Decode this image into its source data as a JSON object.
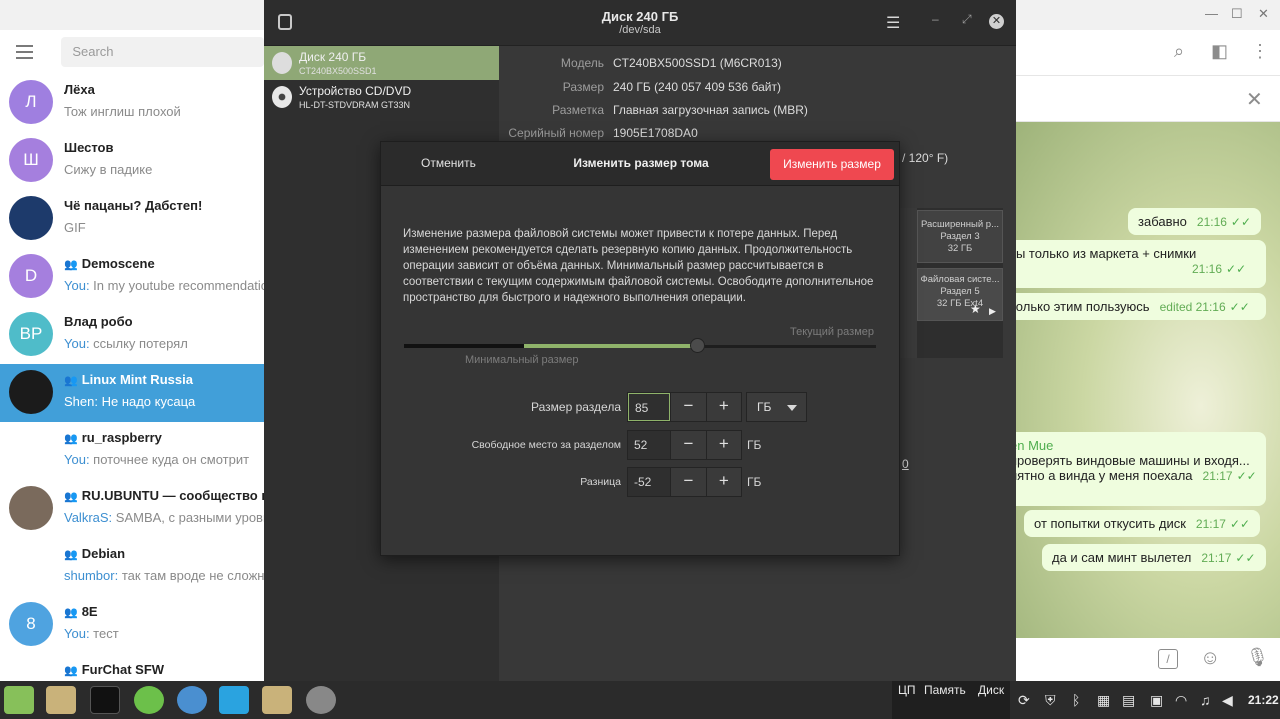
{
  "telegram": {
    "search_placeholder": "Search",
    "chats": [
      {
        "avatar": "Л",
        "avatar_color": "#9f7fe0",
        "name": "Лёха",
        "who": "",
        "preview": "Тож инглиш плохой",
        "group": false
      },
      {
        "avatar": "Ш",
        "avatar_color": "#a57fde",
        "name": "Шестов",
        "who": "",
        "preview": "Сижу в падике",
        "group": false
      },
      {
        "avatar": "",
        "avatar_color": "#1d3a6b",
        "name": "Чё пацаны? Дабстеп!",
        "who": "",
        "preview": "GIF",
        "group": false
      },
      {
        "avatar": "D",
        "avatar_color": "#a57fde",
        "name": "Demoscene",
        "who": "You:",
        "preview": " In my youtube recommendations",
        "group": true
      },
      {
        "avatar": "ВР",
        "avatar_color": "#4fbcc9",
        "name": "Влад робо",
        "who": "You:",
        "preview": " ссылку потерял",
        "group": false
      },
      {
        "avatar": "",
        "avatar_color": "#1b1b1b",
        "name": "Linux Mint Russia",
        "who": "",
        "preview": "Shen: Не надо кусаца",
        "group": true
      },
      {
        "avatar": "",
        "avatar_color": "#ffffff",
        "name": "ru_raspberry",
        "who": "You:",
        "preview": " поточнее куда он смотрит",
        "group": true
      },
      {
        "avatar": "",
        "avatar_color": "#7a6a5c",
        "name": "RU.UBUNTU — сообщество по",
        "who": "ValkraS:",
        "preview": " SAMBA, с разными уровнями",
        "group": true
      },
      {
        "avatar": "",
        "avatar_color": "#ffffff",
        "name": "Debian",
        "who": "shumbor:",
        "preview": " так там вроде не сложно",
        "group": true
      },
      {
        "avatar": "8",
        "avatar_color": "#4fa3e0",
        "name": "8E",
        "who": "You:",
        "preview": " тест",
        "group": true
      },
      {
        "avatar": "",
        "avatar_color": "#ffffff",
        "name": "FurChat SFW",
        "who": "",
        "preview": "",
        "group": true
      }
    ],
    "messages": [
      {
        "text": "забавно",
        "time": "21:16"
      },
      {
        "text": "ты только из маркета + снимки",
        "time": "21:16"
      },
      {
        "text": "только этим пользуюсь",
        "time": "edited 21:16"
      },
      {
        "sender": "en Mue",
        "text": "проверять виндовые машины и входя...",
        "time": ""
      },
      {
        "text": "нятно а винда у меня поехала",
        "time": "21:17"
      },
      {
        "text": "от попытки откусить диск",
        "time": "21:17"
      },
      {
        "text": "да и сам минт вылетел",
        "time": "21:17"
      }
    ]
  },
  "disks": {
    "title": "Диск 240 ГБ",
    "subtitle": "/dev/sda",
    "drives": [
      {
        "name": "Диск 240 ГБ",
        "model": "CT240BX500SSD1"
      },
      {
        "name": "Устройство CD/DVD",
        "model": "HL-DT-STDVDRAM GT33N"
      }
    ],
    "info": [
      {
        "key": "Модель",
        "value": "CT240BX500SSD1 (M6CR013)"
      },
      {
        "key": "Размер",
        "value": "240 ГБ (240 057 409 536 байт)"
      },
      {
        "key": "Разметка",
        "value": "Главная загрузочная запись (MBR)"
      },
      {
        "key": "Серийный номер",
        "value": "1905E1708DA0"
      }
    ],
    "temp_fragment": "/ 120° F)",
    "partitions": [
      {
        "label": "Расширенный р...",
        "sub1": "Раздел 3",
        "sub2": "32 ГБ"
      },
      {
        "label": "Файловая систе...",
        "sub1": "Раздел 5",
        "sub2": "32 ГБ Ext4"
      }
    ],
    "link_fragment": "0"
  },
  "dialog": {
    "cancel": "Отменить",
    "title": "Изменить размер тома",
    "confirm": "Изменить размер",
    "description": "Изменение размера файловой системы может привести к потере данных. Перед изменением рекомендуется сделать резервную копию данных. Продолжительность операции зависит от объёма данных. Минимальный размер рассчитывается в соответствии с текущим содержимым файловой системы. Освободите дополнительное пространство для быстрого и надежного выполнения операции.",
    "current_size_label": "Текущий размер",
    "min_size_label": "Минимальный размер",
    "slider": {
      "min_fraction": 0.255,
      "value_fraction": 0.62
    },
    "fields": [
      {
        "label": "Размер раздела",
        "value": "85",
        "unit": "ГБ",
        "combo": true
      },
      {
        "label": "Свободное место за разделом",
        "value": "52",
        "unit": "ГБ",
        "combo": false
      },
      {
        "label": "Разница",
        "value": "-52",
        "unit": "ГБ",
        "combo": false
      }
    ],
    "minus": "−",
    "plus": "+"
  },
  "taskbar": {
    "cpu": "ЦП",
    "mem": "Память",
    "disk": "Диск",
    "clock": "21:22",
    "apps": [
      "mint-menu-icon",
      "files-icon",
      "terminal-icon",
      "web-icon",
      "chromium-icon",
      "telegram-icon",
      "folder-icon",
      "disks-icon"
    ]
  }
}
